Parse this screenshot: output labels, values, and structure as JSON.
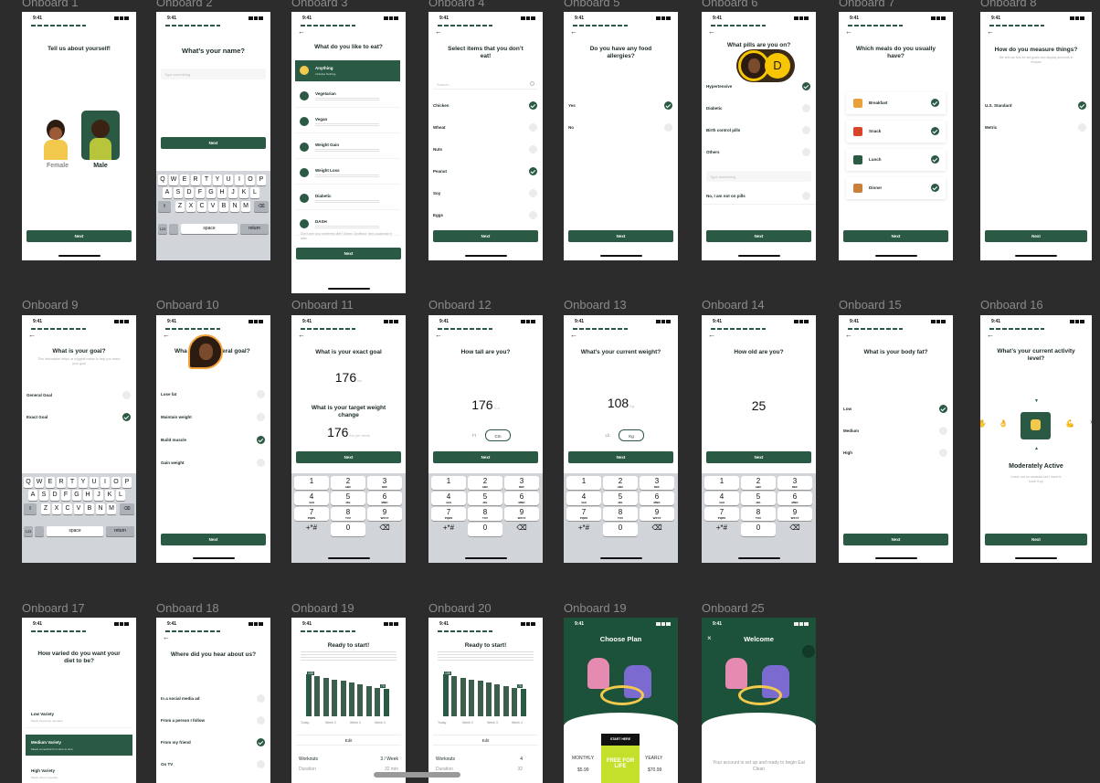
{
  "frames": {
    "onboard1": {
      "label": "Onboard 1",
      "time": "9:41",
      "title": "Tell us about yourself!",
      "female": "Female",
      "male": "Male",
      "next": "Next"
    },
    "onboard2": {
      "label": "Onboard 2",
      "time": "9:41",
      "title": "What’s your name?",
      "placeholder": "Type something",
      "next": "Next",
      "row1": [
        "Q",
        "W",
        "E",
        "R",
        "T",
        "Y",
        "U",
        "I",
        "O",
        "P"
      ],
      "row2": [
        "A",
        "S",
        "D",
        "F",
        "G",
        "H",
        "J",
        "K",
        "L"
      ],
      "row3": [
        "Z",
        "X",
        "C",
        "V",
        "B",
        "N",
        "M"
      ],
      "space": "space",
      "return": "return",
      "num": "123"
    },
    "onboard3": {
      "label": "Onboard 3",
      "time": "9:41",
      "title": "What do you like to eat?",
      "options": [
        {
          "name": "Anything",
          "desc": "Includes Nothing"
        },
        {
          "name": "Vegetarian",
          "desc": ""
        },
        {
          "name": "Vegan",
          "desc": ""
        },
        {
          "name": "Weight Gain",
          "desc": ""
        },
        {
          "name": "Weight Loss",
          "desc": ""
        },
        {
          "name": "Diabetic",
          "desc": ""
        },
        {
          "name": "DASH",
          "desc": ""
        }
      ],
      "footnote": "Don't see your preferred diet? Select 'Anything' then customize it later.",
      "next": "Next"
    },
    "onboard4": {
      "label": "Onboard 4",
      "time": "9:41",
      "title": "Select items that you don’t eat!",
      "search": "Search...",
      "items": [
        {
          "name": "Chicken",
          "on": true
        },
        {
          "name": "Wheat",
          "on": false
        },
        {
          "name": "Nuts",
          "on": false
        },
        {
          "name": "Peanut",
          "on": true
        },
        {
          "name": "Soy",
          "on": false
        },
        {
          "name": "Eggs",
          "on": false
        }
      ],
      "next": "Next"
    },
    "onboard5": {
      "label": "Onboard 5",
      "time": "9:41",
      "title": "Do you have any food allergies?",
      "items": [
        {
          "name": "Yes",
          "on": true
        },
        {
          "name": "No",
          "on": false
        }
      ],
      "next": "Next"
    },
    "onboard6": {
      "label": "Onboard 6",
      "time": "9:41",
      "title": "What pills are you on?",
      "avatar_letter": "D",
      "items": [
        {
          "name": "Hypertensive",
          "on": true
        },
        {
          "name": "Diabetic",
          "on": false
        },
        {
          "name": "Birth control pills",
          "on": false
        },
        {
          "name": "Others",
          "on": false
        }
      ],
      "other_placeholder": "Type something",
      "none": "No, I am not on pills",
      "next": "Next"
    },
    "onboard7": {
      "label": "Onboard 7",
      "time": "9:41",
      "title": "Which meals do you usually have?",
      "items": [
        {
          "name": "Breakfast",
          "on": true
        },
        {
          "name": "Snack",
          "on": true
        },
        {
          "name": "Lunch",
          "on": true
        },
        {
          "name": "Dinner",
          "on": true
        }
      ],
      "next": "Next"
    },
    "onboard8": {
      "label": "Onboard 8",
      "time": "9:41",
      "title": "How do you measure things?",
      "subtitle": "We will use this for set goals and display amounts in recipes",
      "items": [
        {
          "name": "U.S. Standard",
          "on": true
        },
        {
          "name": "Metric",
          "on": false
        }
      ],
      "next": "Next"
    },
    "onboard9": {
      "label": "Onboard 9",
      "time": "9:41",
      "title": "What is your goal?",
      "subtitle": "This information helps us suggest meals to help you reach your goal",
      "items": [
        {
          "name": "General Goal",
          "on": false
        },
        {
          "name": "Exact Goal",
          "on": true
        }
      ],
      "row1": [
        "Q",
        "W",
        "E",
        "R",
        "T",
        "Y",
        "U",
        "I",
        "O",
        "P"
      ],
      "row2": [
        "A",
        "S",
        "D",
        "F",
        "G",
        "H",
        "J",
        "K",
        "L"
      ],
      "row3": [
        "Z",
        "X",
        "C",
        "V",
        "B",
        "N",
        "M"
      ],
      "space": "space",
      "return": "return",
      "num": "123"
    },
    "onboard10": {
      "label": "Onboard 10",
      "time": "9:41",
      "title_left": "Wha",
      "title_right": "eral goal?",
      "items": [
        {
          "name": "Lose fat",
          "on": false
        },
        {
          "name": "Maintain weight",
          "on": false
        },
        {
          "name": "Build muscle",
          "on": true
        },
        {
          "name": "Gain weight",
          "on": false
        }
      ],
      "next": "Next"
    },
    "onboard11": {
      "label": "Onboard 11",
      "time": "9:41",
      "title": "What is your exact goal",
      "value1": "176",
      "unit1": "lbs",
      "title2": "What is your target weight change",
      "value2": "176",
      "unit2": "lbs per week",
      "next": "Next"
    },
    "onboard12": {
      "label": "Onboard 12",
      "time": "9:41",
      "title": "How tall are you?",
      "value": "176",
      "unit": "Cm",
      "opt1": "Ft",
      "opt2": "Cm",
      "next": "Next"
    },
    "onboard13": {
      "label": "Onboard 13",
      "time": "9:41",
      "title": "What’s your current weight?",
      "value": "108",
      "unit": "Kg",
      "opt1": "Lb",
      "opt2": "Kg",
      "next": "Next"
    },
    "onboard14": {
      "label": "Onboard 14",
      "time": "9:41",
      "title": "How old are you?",
      "value": "25",
      "next": "Next"
    },
    "onboard15": {
      "label": "Onboard 15",
      "time": "9:41",
      "title": "What is your body fat?",
      "items": [
        {
          "name": "Low",
          "on": true
        },
        {
          "name": "Medium",
          "on": false
        },
        {
          "name": "High",
          "on": false
        }
      ],
      "next": "Next"
    },
    "onboard16": {
      "label": "Onboard 16",
      "time": "9:41",
      "title": "What’s your current activity level?",
      "level": "Moderately Active",
      "desc": "Leave out on occasion but I want to track it up",
      "next": "Next"
    },
    "onboard17": {
      "label": "Onboard 17",
      "time": "9:41",
      "title": "How varied do you want your diet to be?",
      "items": [
        {
          "name": "Low Variety",
          "desc": "Meals frequently repeated"
        },
        {
          "name": "Medium Variety",
          "desc": "Meals somewhat from time to time"
        },
        {
          "name": "High Variety",
          "desc": "Meals rarely repeated"
        }
      ]
    },
    "onboard18": {
      "label": "Onboard 18",
      "time": "9:41",
      "title": "Where did you hear about us?",
      "items": [
        {
          "name": "In a social media ad",
          "on": false
        },
        {
          "name": "From a person I follow",
          "on": false
        },
        {
          "name": "From my friend",
          "on": true
        },
        {
          "name": "On TV",
          "on": false
        }
      ]
    },
    "onboard19": {
      "label": "Onboard 19",
      "time": "9:41",
      "title": "Ready to start!",
      "edit": "Edit",
      "workouts_label": "Workouts",
      "workouts_value": "3 / Week",
      "duration_label": "Duration",
      "duration_value": "32 min",
      "start_value": "108",
      "end_value": "70",
      "ticks": [
        "Today",
        "Week 2",
        "Week 3",
        "Week 4"
      ]
    },
    "onboard20": {
      "label": "Onboard 20",
      "time": "9:41",
      "title": "Ready to start!",
      "edit": "Edit",
      "workouts_label": "Workouts",
      "workouts_value": "4",
      "duration_label": "Duration",
      "duration_value": "32",
      "start_value": "108",
      "end_value": "70",
      "ticks": [
        "Today",
        "Week 2",
        "Week 3",
        "Week 4"
      ]
    },
    "onboard19b": {
      "label": "Onboard 19",
      "time": "9:41",
      "title": "Choose Plan",
      "start_here": "START HERE",
      "free": "FREE FOR LIFE",
      "monthly": "MONTHLY",
      "monthly_price": "$5.99",
      "yearly": "YEARLY",
      "yearly_price": "$70.99"
    },
    "onboard25": {
      "label": "Onboard 25",
      "time": "9:41",
      "title": "Welcome",
      "message": "Your account is set up and ready to begin Eat Clean"
    }
  },
  "colors": {
    "brand": "#2b5a44",
    "canvas": "#2c2c2c",
    "label": "#8a8a8a"
  }
}
